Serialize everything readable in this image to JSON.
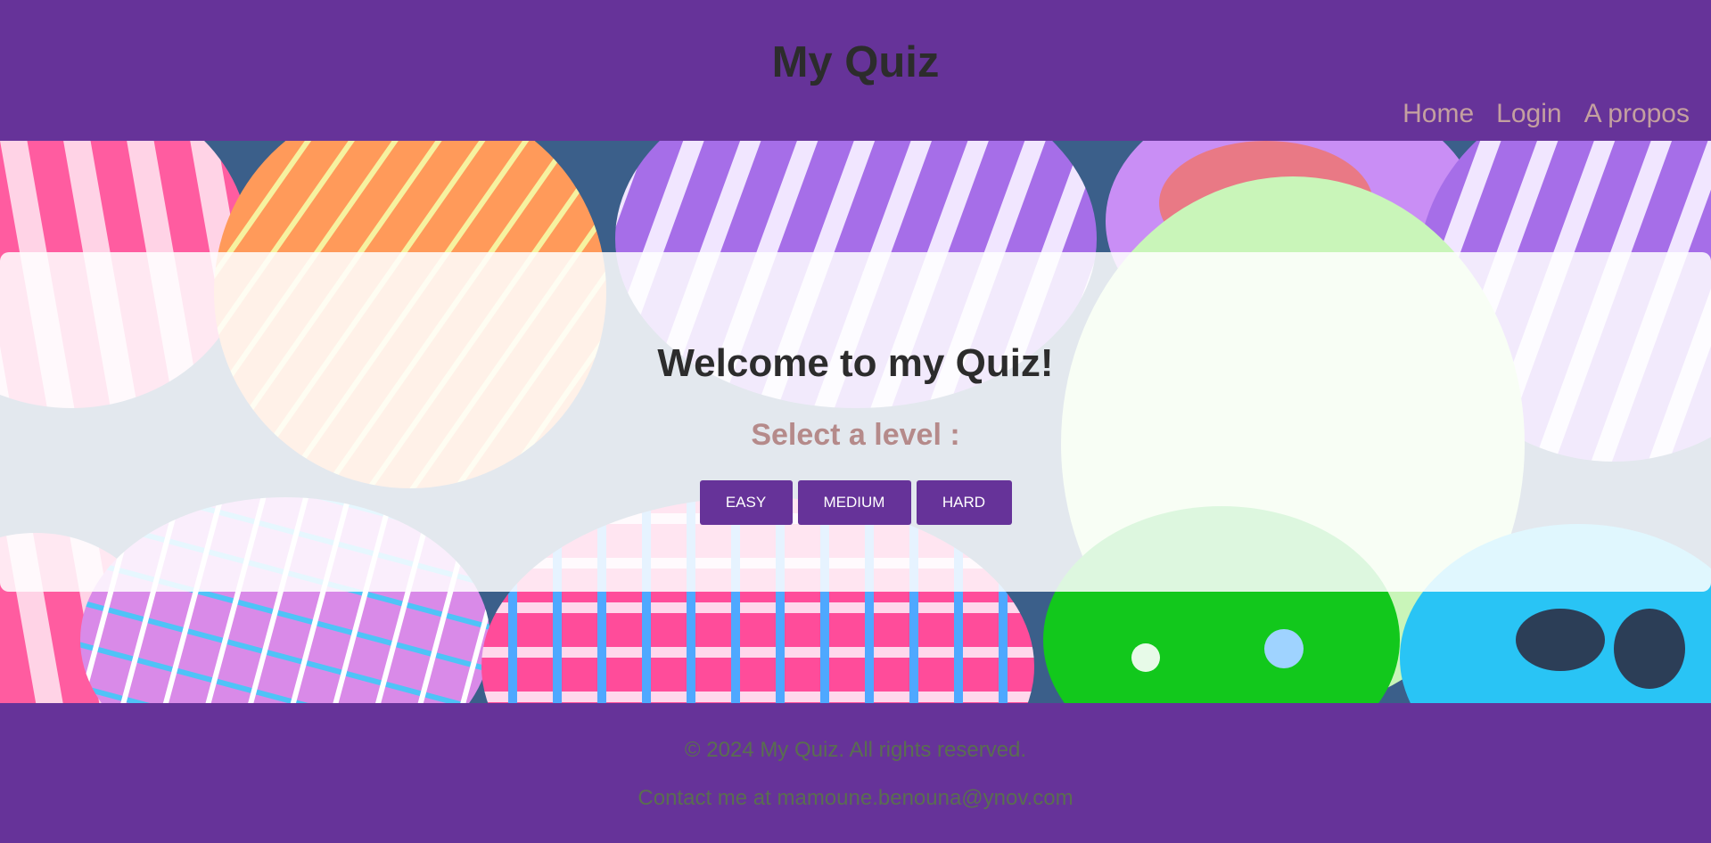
{
  "header": {
    "title": "My Quiz",
    "nav": [
      "Home",
      "Login",
      "A propos"
    ]
  },
  "hero": {
    "background": "easter-eggs-image"
  },
  "card": {
    "title": "Welcome to my Quiz!",
    "subtitle": "Select a level :",
    "levels": [
      "EASY",
      "MEDIUM",
      "HARD"
    ]
  },
  "footer": {
    "copyright": "© 2024 My Quiz. All rights reserved.",
    "contact": "Contact me at mamoune.benouna@ynov.com"
  },
  "colors": {
    "brand_purple": "#663399",
    "title_text": "#2c2c2c",
    "nav_text": "#c4a0a0",
    "subtitle_text": "#b58a8a",
    "footer_text": "#5a6e50"
  }
}
